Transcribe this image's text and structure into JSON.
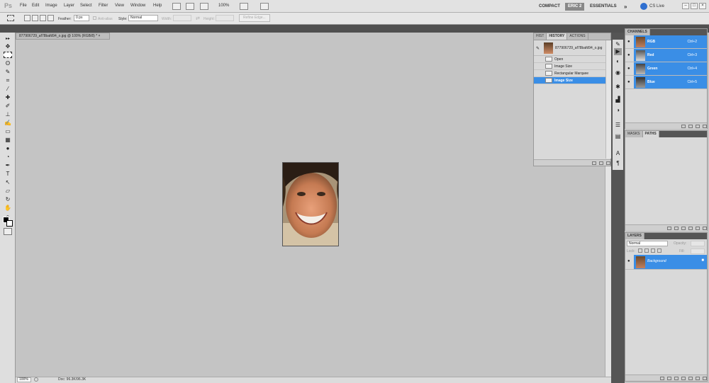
{
  "app": {
    "logo": "Ps"
  },
  "menu": [
    "File",
    "Edit",
    "Image",
    "Layer",
    "Select",
    "Filter",
    "View",
    "Window",
    "Help"
  ],
  "menubar": {
    "zoom": "100%"
  },
  "workspace": {
    "compact": "COMPACT",
    "current": "ERIC 2",
    "essentials": "ESSENTIALS",
    "more": "»",
    "cslive": "CS Live"
  },
  "window_controls": {
    "minimize": "–",
    "maximize": "□",
    "close": "×"
  },
  "options": {
    "feather_label": "Feather:",
    "feather_value": "0 px",
    "antialias_label": "Anti-alias",
    "style_label": "Style:",
    "style_value": "Normal",
    "width_label": "Width:",
    "height_label": "Height:",
    "refine_edge": "Refine Edge..."
  },
  "document": {
    "tab_title": "877906729_af78bafd94_o.jpg @ 100% (RGB/8) *",
    "tab_close": "×"
  },
  "status": {
    "zoom": "100%",
    "doc": "Doc: 96.3K/96.3K"
  },
  "history": {
    "tabs": [
      "HIST",
      "HISTORY",
      "ACTIONS"
    ],
    "snapshot": "877906729_af78bafd94_o.jpg",
    "items": [
      {
        "label": "Open",
        "selected": false
      },
      {
        "label": "Image Size",
        "selected": false
      },
      {
        "label": "Rectangular Marquee",
        "selected": false
      },
      {
        "label": "Image Size",
        "selected": true
      }
    ]
  },
  "channels": {
    "tab": "CHANNELS",
    "items": [
      {
        "name": "RGB",
        "shortcut": "Ctrl+2"
      },
      {
        "name": "Red",
        "shortcut": "Ctrl+3"
      },
      {
        "name": "Green",
        "shortcut": "Ctrl+4"
      },
      {
        "name": "Blue",
        "shortcut": "Ctrl+5"
      }
    ]
  },
  "paths": {
    "tabs": [
      "MASKS",
      "PATHS"
    ]
  },
  "layers": {
    "tab": "LAYERS",
    "blend": "Normal",
    "opacity_label": "Opacity:",
    "lock_label": "Lock:",
    "fill_label": "Fill:",
    "layer": "Background"
  },
  "colors": {
    "accent": "#3a8ee6",
    "chrome": "#e2e2e2",
    "canvas": "#c4c4c4"
  }
}
